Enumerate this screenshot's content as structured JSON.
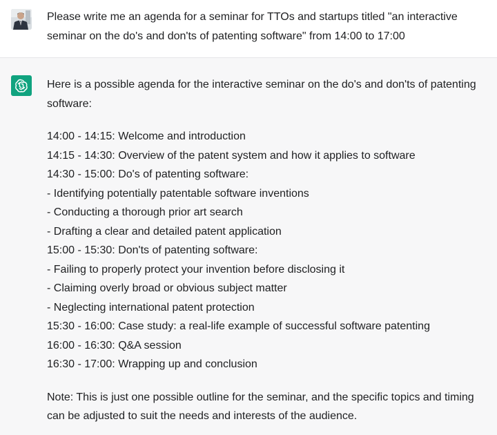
{
  "conversation": {
    "user": {
      "avatar_icon": "user-photo-avatar",
      "text": "Please write me an agenda for a seminar for TTOs and startups titled \"an interactive seminar on the do's and don'ts of patenting software\" from 14:00 to 17:00"
    },
    "assistant": {
      "avatar_icon": "openai-logo-icon",
      "accent_color": "#10a37f",
      "intro": "Here is a possible agenda for the interactive seminar on the do's and don'ts of patenting software:",
      "agenda": [
        "14:00 - 14:15: Welcome and introduction",
        "14:15 - 14:30: Overview of the patent system and how it applies to software",
        "14:30 - 15:00: Do's of patenting software:",
        "- Identifying potentially patentable software inventions",
        "- Conducting a thorough prior art search",
        "- Drafting a clear and detailed patent application",
        "15:00 - 15:30: Don'ts of patenting software:",
        "- Failing to properly protect your invention before disclosing it",
        "- Claiming overly broad or obvious subject matter",
        "- Neglecting international patent protection",
        "15:30 - 16:00: Case study: a real-life example of successful software patenting",
        "16:00 - 16:30: Q&A session",
        "16:30 - 17:00: Wrapping up and conclusion"
      ],
      "note": "Note: This is just one possible outline for the seminar, and the specific topics and timing can be adjusted to suit the needs and interests of the audience."
    }
  }
}
